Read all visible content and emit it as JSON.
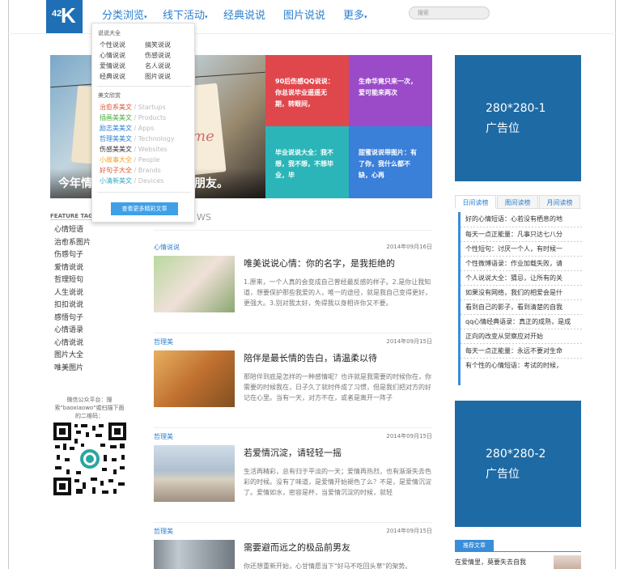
{
  "logo": {
    "num": "42",
    "letter": "K"
  },
  "nav": {
    "items": [
      "分类浏览",
      "线下活动",
      "经典说说",
      "图片说说",
      "更多"
    ],
    "caret": "▾"
  },
  "search": {
    "placeholder": "搜索"
  },
  "dropdown": {
    "heading1": "说说大全",
    "col1": [
      "个性说说",
      "心情说说",
      "爱情说说",
      "经典说说"
    ],
    "col2": [
      "搞笑说说",
      "伤感说说",
      "名人说说",
      "图片说说"
    ],
    "heading2": "美文欣赏",
    "items": [
      {
        "name": "治愈系美文",
        "sub": " / Startups",
        "color": "#e0542e"
      },
      {
        "name": "插画美美文",
        "sub": " / Products",
        "color": "#4aa83c"
      },
      {
        "name": "励志美美文",
        "sub": " / Apps",
        "color": "#2a7fcf"
      },
      {
        "name": "哲理美美文",
        "sub": " / Technology",
        "color": "#2a7fcf"
      },
      {
        "name": "伤感美美文",
        "sub": " / Websites",
        "color": "#333333"
      },
      {
        "name": "小故事大全",
        "sub": " / People",
        "color": "#f0a020"
      },
      {
        "name": "好句子大全",
        "sub": " / Brands",
        "color": "#e0542e"
      },
      {
        "name": "小清新美文",
        "sub": " / Devices",
        "color": "#2aa8c8"
      }
    ],
    "more_button": "查看更多精彩文章"
  },
  "slider": {
    "caption": "今年情人节，我想送一个男朋友。",
    "handwriting": "me"
  },
  "tiles": [
    {
      "text": "90后伤感QQ说说：你总说毕业遥遥无期，转眼间，",
      "color": "#e0474c"
    },
    {
      "text": "生命华竟只来一次，爱可能来两次",
      "color": "#9b4bc8"
    },
    {
      "text": "毕业说说大全：我不想，我不想，不想毕业，毕",
      "color": "#2bb5b8"
    },
    {
      "text": "甜蜜说说带图片：有了你，我什么都不缺，心再",
      "color": "#3a7fd8"
    }
  ],
  "ads": [
    {
      "size": "280*280-1",
      "label": "广告位"
    },
    {
      "size": "280*280-2",
      "label": "广告位"
    }
  ],
  "tabs": [
    "日间读榜",
    "周间读榜",
    "月间读榜"
  ],
  "ranking": [
    "好的心情短语：心若没有栖息的地",
    "每天一点正能量：凡事只达七八分",
    "个性短句：讨厌一个人，有时候一",
    "个性微博语录：作业加载失败，请",
    "个人说说大全：猜忌，让所有的关",
    "如果没有网络，我们的相爱会是什",
    "看到自己的影子，看到清楚的自我",
    "qq心情经典语录：真正的成熟，是成",
    "正向的改变从觉察应对开始",
    "每天一点正能量：永远不要对生命",
    "有个性的心情短语：考试的时候，"
  ],
  "recommend": {
    "label": "推荐文章",
    "first": "在爱情里，莫要失去自我"
  },
  "feature_tags": {
    "title": "FEATURE TAGS",
    "items": [
      "心情短语",
      "治愈系图片",
      "伤感句子",
      "爱情说说",
      "哲理短句",
      "人生说说",
      "扣扣说说",
      "感悟句子",
      "心情语录",
      "心情说说",
      "图片大全",
      "唯美图片"
    ]
  },
  "wechat": {
    "line1": "微信公众平台：搜",
    "line2": "索\"baoxiaowo\"或扫描下面",
    "line3": "的二维码："
  },
  "news_heading": "WS",
  "articles": [
    {
      "cat": "心情说说",
      "date": "2014年09月16日",
      "title": "唯美说说心情：你的名字，是我拒绝的",
      "excerpt": "1.原来，一个人真的会变成自己曾经最反感的样子。2.是你让我知道，想要保护那些我爱的人，唯一的途径，就是我自己变得更好，更强大。3.别对我太好，免得我以身相许你又不要。",
      "thumb": "linear-gradient(135deg,#b8d8a0,#f0e0d8 50%,#8aa870)"
    },
    {
      "cat": "哲理美",
      "date": "2014年09月15日",
      "title": "陪伴是最长情的告白，请温柔以待",
      "excerpt": "那陪伴到底是怎样的一种感情呢？也许就是我需要的时候你在，你需要的时候我在，日子久了就时件成了习惯，但是我们把对方的好记在心里。当有一天，对方不在，或者是离开一阵子",
      "thumb": "linear-gradient(135deg,#e8b060,#c07030 50%,#805020)"
    },
    {
      "cat": "哲理美",
      "date": "2014年09月15日",
      "title": "若爱情沉淀，请轻轻一摇",
      "excerpt": "生活再精彩，总有归于平淡的一天；爱情再热烈，也有渐渐失去色彩的时候。没有了味道，是爱情开始褪色了么？不是，是爱情沉淀了。爱情如水，密容是杯，当爱情沉淀的时候，就轻",
      "thumb": "linear-gradient(180deg,#d0dce8,#b0c0d0 45%,#d8d0c0 60%,#a09080)"
    },
    {
      "cat": "哲理美",
      "date": "2014年09月15日",
      "title": "需要避而远之的极品前男友",
      "excerpt": "你还想重新开始，心甘情愿当下\"好马不吃回头草\"的架势。",
      "thumb": "linear-gradient(90deg,#808890,#c0c8d0 30%,#707880)"
    }
  ]
}
